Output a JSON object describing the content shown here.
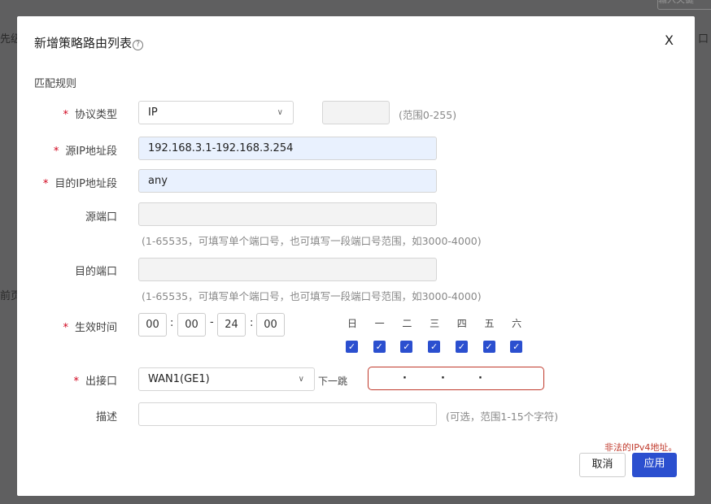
{
  "background": {
    "left_text_1": "先级",
    "left_text_2": "前页",
    "right_text": "口",
    "top_right_text": "输入关键"
  },
  "dialog": {
    "title": "新增策略路由列表",
    "help_icon": "?",
    "close_label": "X",
    "section": "匹配规则",
    "protocol": {
      "label": "协议类型",
      "value": "IP",
      "number_value": "",
      "hint": "(范围0-255)"
    },
    "src_ip": {
      "label": "源IP地址段",
      "value": "192.168.3.1-192.168.3.254"
    },
    "dst_ip": {
      "label": "目的IP地址段",
      "value": "any"
    },
    "src_port": {
      "label": "源端口",
      "value": "",
      "hint": "(1-65535，可填写单个端口号，也可填写一段端口号范围，如3000-4000)"
    },
    "dst_port": {
      "label": "目的端口",
      "value": "",
      "hint": "(1-65535，可填写单个端口号，也可填写一段端口号范围，如3000-4000)"
    },
    "time": {
      "label": "生效时间",
      "start_h": "00",
      "start_m": "00",
      "end_h": "24",
      "end_m": "00",
      "colon": ":",
      "dash": "-"
    },
    "days": [
      {
        "label": "日",
        "checked": true
      },
      {
        "label": "一",
        "checked": true
      },
      {
        "label": "二",
        "checked": true
      },
      {
        "label": "三",
        "checked": true
      },
      {
        "label": "四",
        "checked": true
      },
      {
        "label": "五",
        "checked": true
      },
      {
        "label": "六",
        "checked": true
      }
    ],
    "egress": {
      "label": "出接口",
      "value": "WAN1(GE1)",
      "next_hop_label": "下一跳",
      "next_hop_value": "",
      "dots": "·"
    },
    "description": {
      "label": "描述",
      "value": "",
      "hint": "(可选，范围1-15个字符)"
    },
    "error": "非法的IPv4地址。",
    "cancel_label": "取消",
    "apply_label": "应用"
  },
  "colors": {
    "primary": "#2b4fcf",
    "error": "#c0392b",
    "required": "#d0021b"
  }
}
